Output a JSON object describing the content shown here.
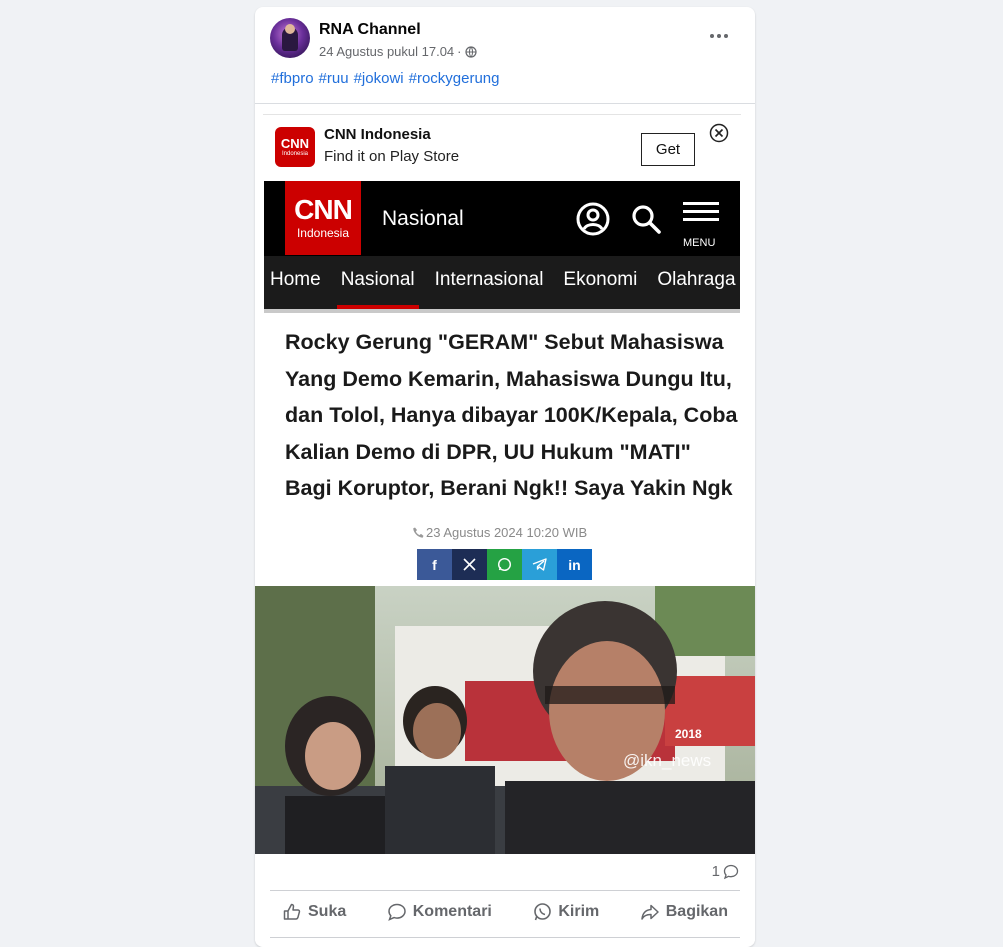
{
  "post": {
    "page_name": "RNA Channel",
    "timestamp": "24 Agustus pukul 17.04",
    "separator": "·",
    "hashtags": [
      "#fbpro",
      "#ruu",
      "#jokowi",
      "#rockygerung"
    ]
  },
  "app_banner": {
    "logo_text": "CNN",
    "logo_sub": "Indonesia",
    "title": "CNN Indonesia",
    "subtitle": "Find it on Play Store",
    "get_label": "Get"
  },
  "cnn_nav": {
    "logo_text": "CNN",
    "logo_sub": "Indonesia",
    "section": "Nasional",
    "menu_label": "MENU",
    "tabs": [
      "Home",
      "Nasional",
      "Internasional",
      "Ekonomi",
      "Olahraga"
    ],
    "active_tab": "Nasional"
  },
  "article": {
    "headline": "Rocky Gerung \"GERAM\"  Sebut Mahasiswa Yang Demo Kemarin, Mahasiswa Dungu Itu, dan Tolol, Hanya dibayar 100K/Kepala, Coba Kalian Demo di DPR, UU Hukum \"MATI\" Bagi Koruptor, Berani Ngk!! Saya Yakin Ngk",
    "date": "23 Agustus 2024 10:20 WIB"
  },
  "share_buttons": [
    {
      "name": "facebook",
      "glyph": "f",
      "color": "#3b5998"
    },
    {
      "name": "x",
      "glyph": "𝕏",
      "color": "#1d2d55"
    },
    {
      "name": "whatsapp",
      "glyph": "✆",
      "color": "#25a244"
    },
    {
      "name": "telegram",
      "glyph": "➤",
      "color": "#2a9fd8"
    },
    {
      "name": "linkedin",
      "glyph": "in",
      "color": "#0a66c2"
    }
  ],
  "photo": {
    "watermark": "@ikn_news",
    "sign_text": "2018"
  },
  "footer": {
    "comment_count": "1",
    "actions": {
      "like": "Suka",
      "comment": "Komentari",
      "send": "Kirim",
      "share": "Bagikan"
    }
  },
  "colors": {
    "link": "#216fdb",
    "cnn_red": "#cc0000",
    "muted": "#65676b"
  }
}
